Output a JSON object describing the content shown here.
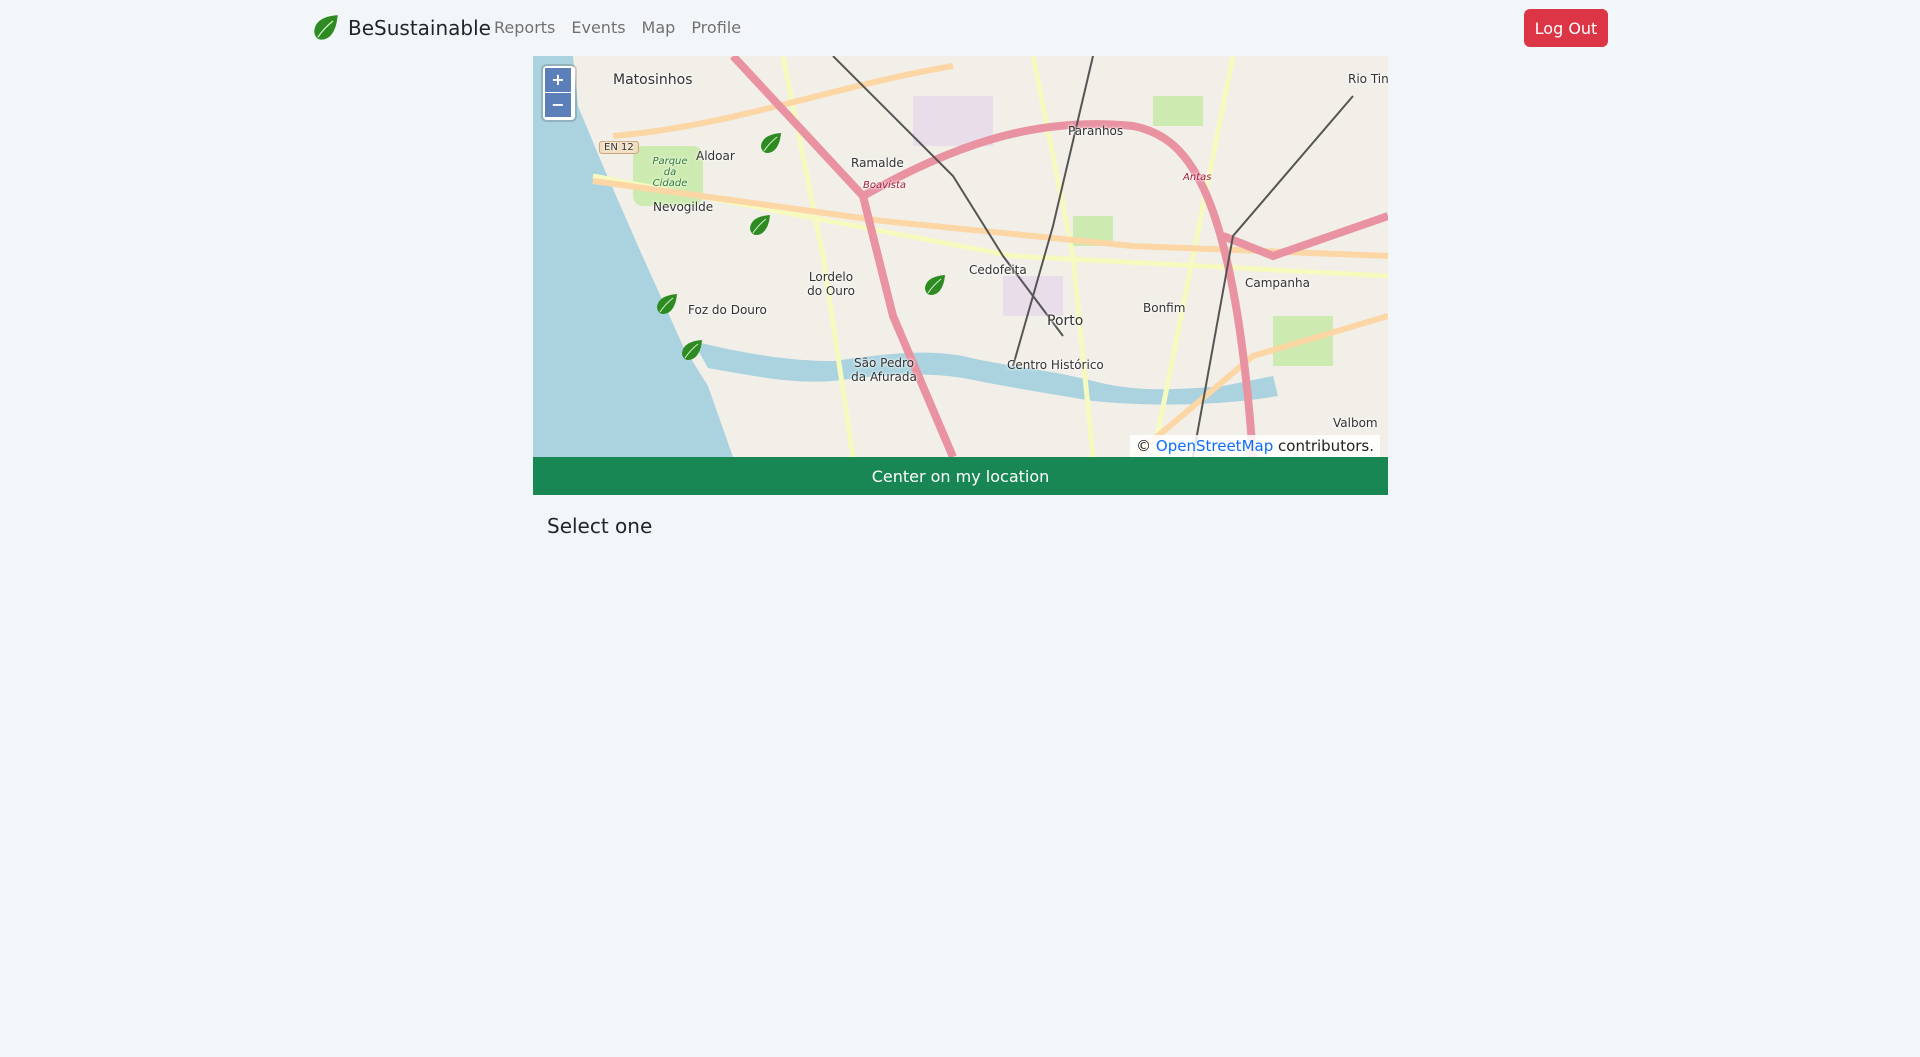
{
  "brand": {
    "name": "BeSustainable",
    "icon": "leaf-icon",
    "color": "#2e8b22"
  },
  "nav": {
    "items": [
      {
        "label": "Reports"
      },
      {
        "label": "Events"
      },
      {
        "label": "Map"
      },
      {
        "label": "Profile"
      }
    ]
  },
  "logout_label": "Log Out",
  "map": {
    "zoom_in": "+",
    "zoom_out": "−",
    "places": [
      "Matosinhos",
      "Aldoar",
      "Ramalde",
      "Paranhos",
      "Nevogilde",
      "Cedofeita",
      "Lordelo do Ouro",
      "Campanha",
      "Bonfim",
      "Porto",
      "Foz do Douro",
      "São Pedro da Afurada",
      "Centro Histórico",
      "Valbom",
      "Rio Tinto",
      "EN 12",
      "Parque da Cidade",
      "Boavista",
      "Antas"
    ],
    "marker_icon": "leaf-icon",
    "attribution": {
      "prefix": "©",
      "link": "OpenStreetMap",
      "suffix": "contributors."
    }
  },
  "center_button": "Center on my location",
  "select_text": "Select one",
  "colors": {
    "primary": "#198754",
    "danger": "#dc3545",
    "water": "#aad3df"
  }
}
